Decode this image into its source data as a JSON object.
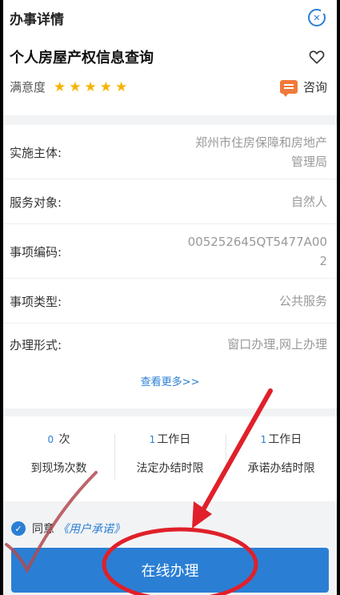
{
  "header": {
    "title": "办事详情",
    "close_symbol": "✕"
  },
  "service": {
    "title": "个人房屋产权信息查询",
    "satisfaction_label": "满意度",
    "stars": 5,
    "consult_label": "咨询",
    "favorite_icon": "heart-outline-icon",
    "consult_icon": "chat-bubble-icon"
  },
  "details": {
    "rows": [
      {
        "label": "实施主体:",
        "value_line1": "郑州市住房保障和房地产",
        "value_line2": "管理局"
      },
      {
        "label": "服务对象:",
        "value_line1": "自然人",
        "value_line2": ""
      },
      {
        "label": "事项编码:",
        "value_line1": "005252645QT5477A00",
        "value_line2": "2"
      },
      {
        "label": "事项类型:",
        "value_line1": "公共服务",
        "value_line2": ""
      },
      {
        "label": "办理形式:",
        "value_line1": "窗口办理,网上办理",
        "value_line2": ""
      }
    ],
    "more_label": "查看更多>>"
  },
  "stats": [
    {
      "number": "0",
      "unit": "次",
      "label": "到现场次数"
    },
    {
      "number": "1",
      "unit": "工作日",
      "label": "法定办结时限"
    },
    {
      "number": "1",
      "unit": "工作日",
      "label": "承诺办结时限"
    }
  ],
  "agreement": {
    "checked": true,
    "agree_text": "同意",
    "link_text": "《用户承诺》"
  },
  "action": {
    "online_button_label": "在线办理"
  },
  "colors": {
    "accent": "#2a7fd4",
    "star": "#f5b400",
    "consult": "#f07a3a",
    "annotation": "#e0202a"
  }
}
